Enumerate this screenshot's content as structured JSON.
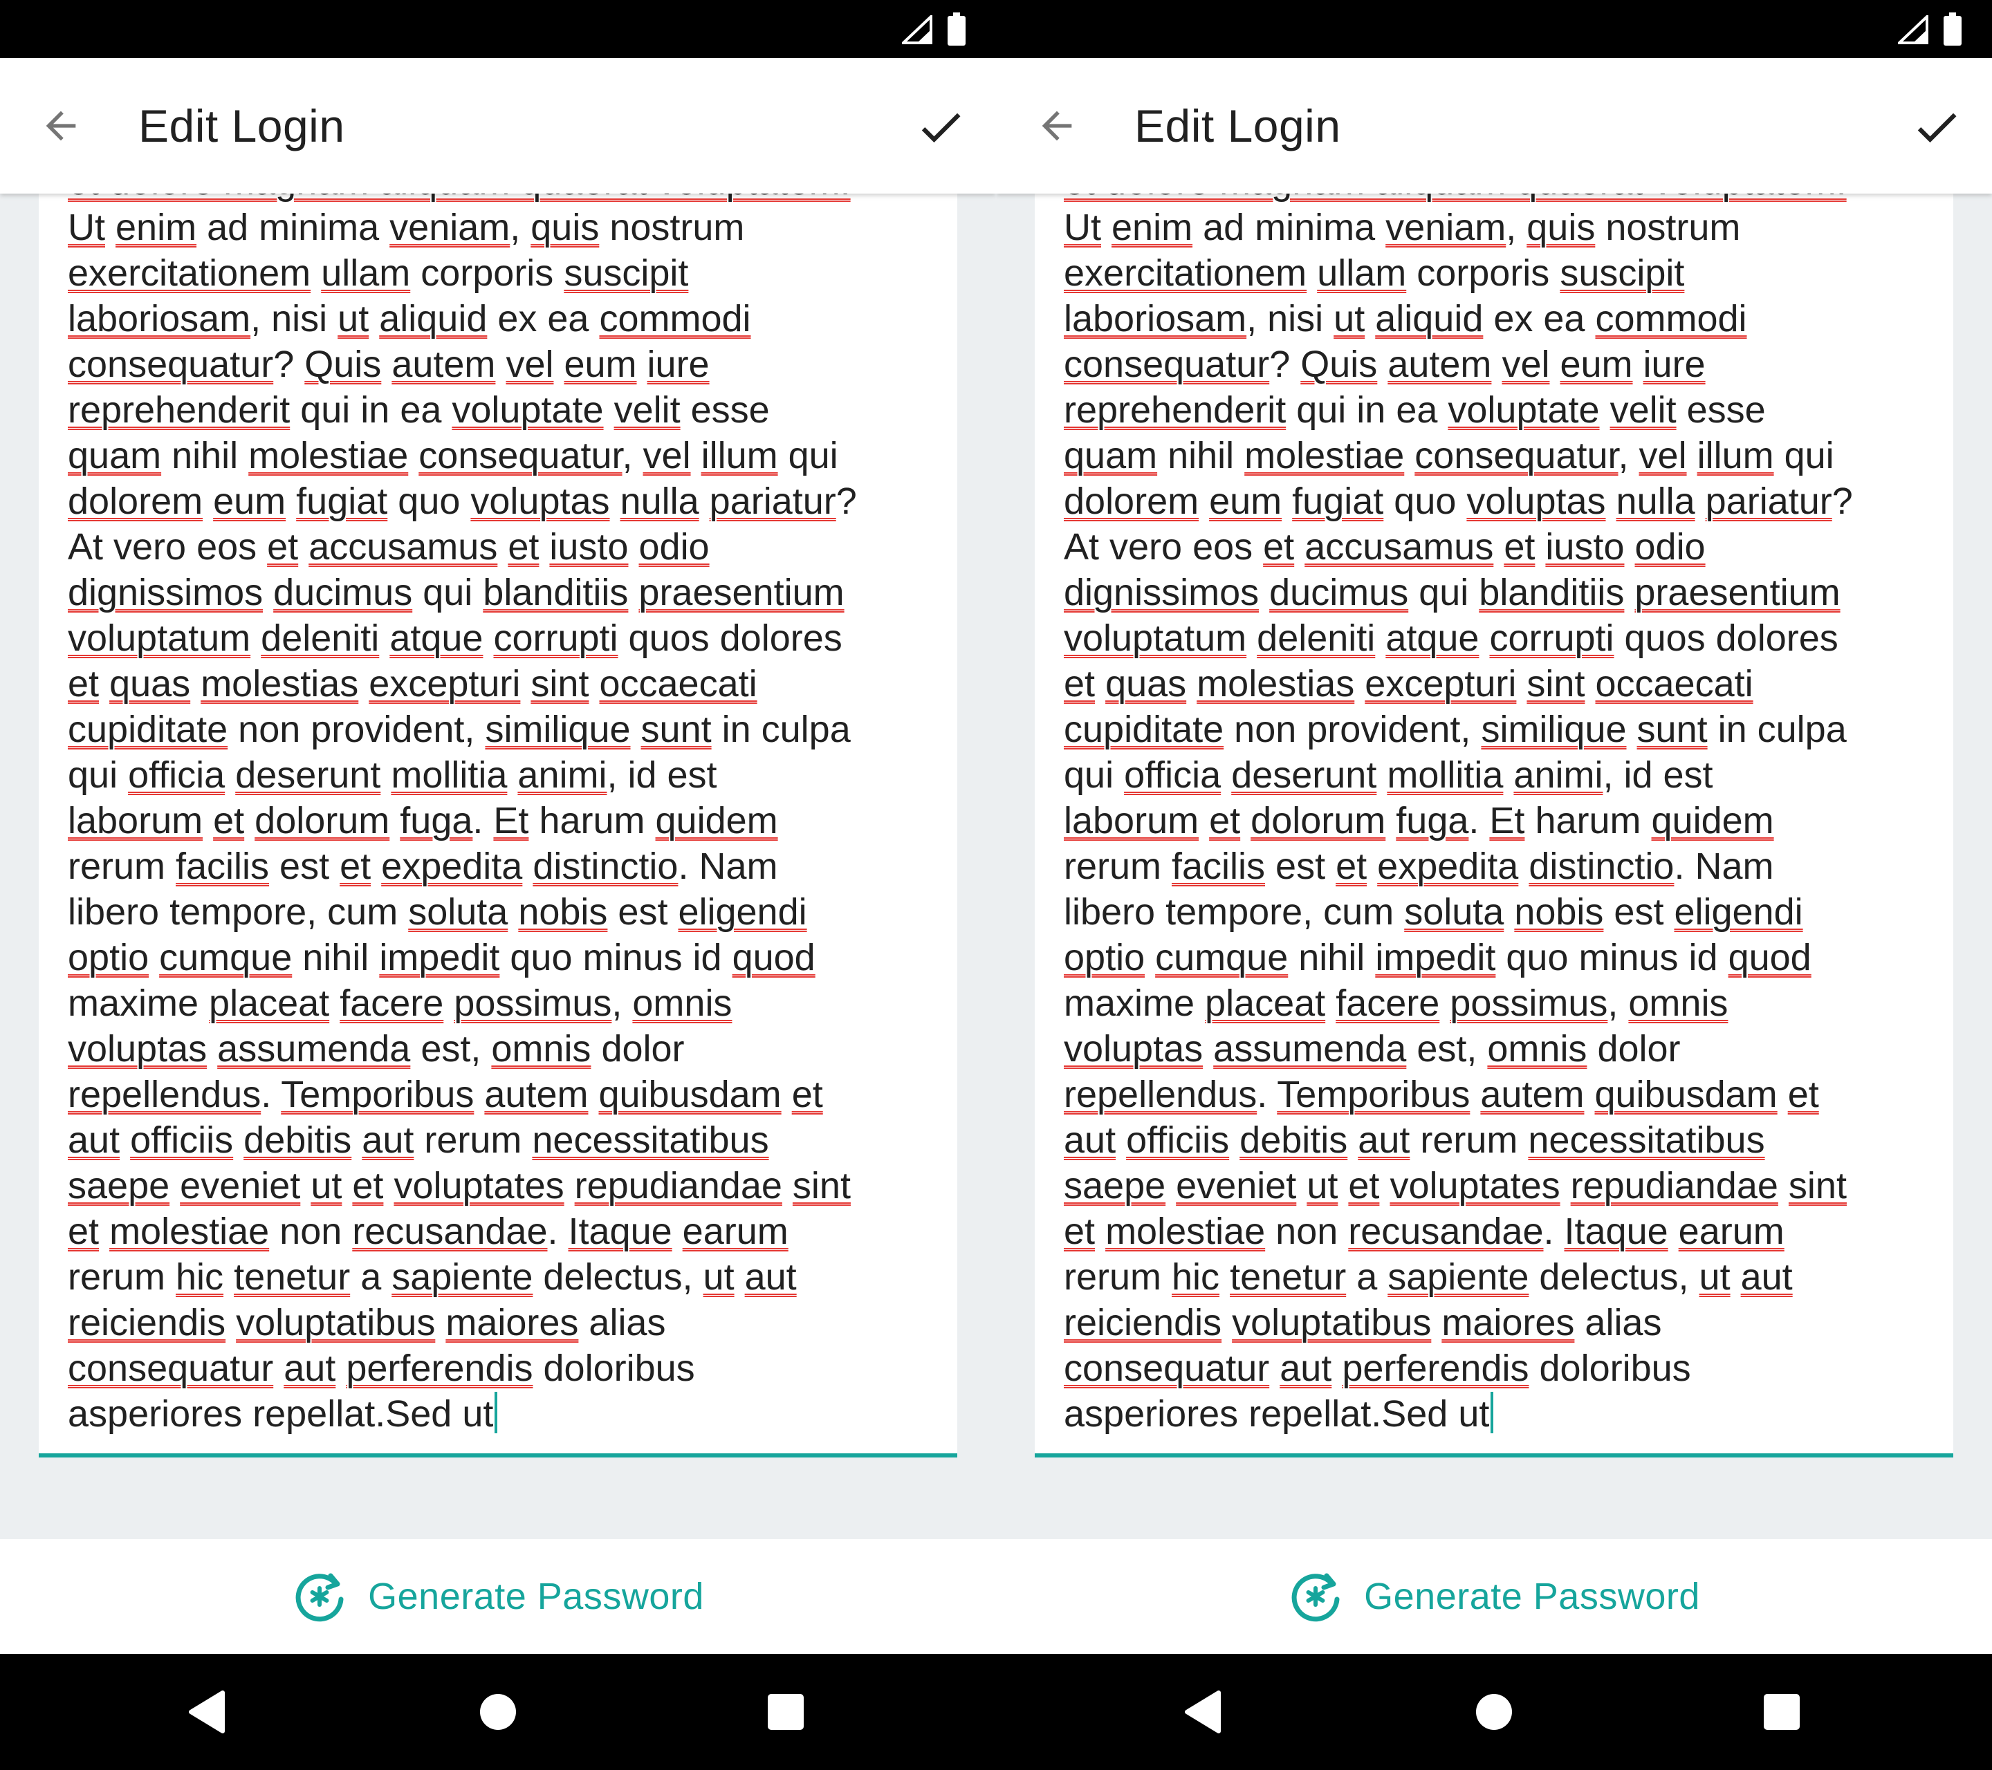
{
  "colors": {
    "accent": "#16a59c",
    "spell_error": "#e53935",
    "text": "#212121",
    "background": "#eceff1"
  },
  "icons": {
    "back": "arrow-left-icon",
    "save": "check-icon",
    "generate": "refresh-asterisk-icon",
    "signal": "signal-icon",
    "battery": "battery-icon",
    "nav_back": "triangle-back-icon",
    "nav_home": "circle-home-icon",
    "nav_recents": "square-recents-icon"
  },
  "screen": {
    "title": "Edit Login",
    "generate_label": "Generate Password",
    "editor_tokens": [
      {
        "t": "et dolore magnam aliquam quaerat voluptatem.\n",
        "s": true
      },
      {
        "t": "Ut",
        "s": true
      },
      {
        "t": " ",
        "s": false
      },
      {
        "t": "enim",
        "s": true
      },
      {
        "t": " ad minima ",
        "s": false
      },
      {
        "t": "veniam",
        "s": true
      },
      {
        "t": ", ",
        "s": false
      },
      {
        "t": "quis",
        "s": true
      },
      {
        "t": " nostrum\n",
        "s": false
      },
      {
        "t": "exercitationem",
        "s": true
      },
      {
        "t": " ",
        "s": false
      },
      {
        "t": "ullam",
        "s": true
      },
      {
        "t": " corporis ",
        "s": false
      },
      {
        "t": "suscipit",
        "s": true
      },
      {
        "t": "\n",
        "s": false
      },
      {
        "t": "laboriosam",
        "s": true
      },
      {
        "t": ", nisi ",
        "s": false
      },
      {
        "t": "ut",
        "s": true
      },
      {
        "t": " ",
        "s": false
      },
      {
        "t": "aliquid",
        "s": true
      },
      {
        "t": " ex ea ",
        "s": false
      },
      {
        "t": "commodi",
        "s": true
      },
      {
        "t": "\n",
        "s": false
      },
      {
        "t": "consequatur",
        "s": true
      },
      {
        "t": "? ",
        "s": false
      },
      {
        "t": "Quis",
        "s": true
      },
      {
        "t": " ",
        "s": false
      },
      {
        "t": "autem",
        "s": true
      },
      {
        "t": " ",
        "s": false
      },
      {
        "t": "vel",
        "s": true
      },
      {
        "t": " ",
        "s": false
      },
      {
        "t": "eum",
        "s": true
      },
      {
        "t": " ",
        "s": false
      },
      {
        "t": "iure",
        "s": true
      },
      {
        "t": "\n",
        "s": false
      },
      {
        "t": "reprehenderit",
        "s": true
      },
      {
        "t": " qui in ea ",
        "s": false
      },
      {
        "t": "voluptate",
        "s": true
      },
      {
        "t": " ",
        "s": false
      },
      {
        "t": "velit",
        "s": true
      },
      {
        "t": " esse\n",
        "s": false
      },
      {
        "t": "quam",
        "s": true
      },
      {
        "t": " nihil ",
        "s": false
      },
      {
        "t": "molestiae",
        "s": true
      },
      {
        "t": " ",
        "s": false
      },
      {
        "t": "consequatur",
        "s": true
      },
      {
        "t": ", ",
        "s": false
      },
      {
        "t": "vel",
        "s": true
      },
      {
        "t": " ",
        "s": false
      },
      {
        "t": "illum",
        "s": true
      },
      {
        "t": " qui\n",
        "s": false
      },
      {
        "t": "dolorem",
        "s": true
      },
      {
        "t": " ",
        "s": false
      },
      {
        "t": "eum",
        "s": true
      },
      {
        "t": " ",
        "s": false
      },
      {
        "t": "fugiat",
        "s": true
      },
      {
        "t": " quo ",
        "s": false
      },
      {
        "t": "voluptas",
        "s": true
      },
      {
        "t": " ",
        "s": false
      },
      {
        "t": "nulla",
        "s": true
      },
      {
        "t": " ",
        "s": false
      },
      {
        "t": "pariatur",
        "s": true
      },
      {
        "t": "?\n",
        "s": false
      },
      {
        "t": "At vero eos ",
        "s": false
      },
      {
        "t": "et",
        "s": true
      },
      {
        "t": " ",
        "s": false
      },
      {
        "t": "accusamus",
        "s": true
      },
      {
        "t": " ",
        "s": false
      },
      {
        "t": "et",
        "s": true
      },
      {
        "t": " ",
        "s": false
      },
      {
        "t": "iusto",
        "s": true
      },
      {
        "t": " ",
        "s": false
      },
      {
        "t": "odio",
        "s": true
      },
      {
        "t": "\n",
        "s": false
      },
      {
        "t": "dignissimos",
        "s": true
      },
      {
        "t": " ",
        "s": false
      },
      {
        "t": "ducimus",
        "s": true
      },
      {
        "t": " qui ",
        "s": false
      },
      {
        "t": "blanditiis",
        "s": true
      },
      {
        "t": " ",
        "s": false
      },
      {
        "t": "praesentium",
        "s": true
      },
      {
        "t": "\n",
        "s": false
      },
      {
        "t": "voluptatum",
        "s": true
      },
      {
        "t": " ",
        "s": false
      },
      {
        "t": "deleniti",
        "s": true
      },
      {
        "t": " ",
        "s": false
      },
      {
        "t": "atque",
        "s": true
      },
      {
        "t": " ",
        "s": false
      },
      {
        "t": "corrupti",
        "s": true
      },
      {
        "t": " quos dolores\n",
        "s": false
      },
      {
        "t": "et",
        "s": true
      },
      {
        "t": " ",
        "s": false
      },
      {
        "t": "quas",
        "s": true
      },
      {
        "t": " ",
        "s": false
      },
      {
        "t": "molestias",
        "s": true
      },
      {
        "t": " ",
        "s": false
      },
      {
        "t": "excepturi",
        "s": true
      },
      {
        "t": " ",
        "s": false
      },
      {
        "t": "sint",
        "s": true
      },
      {
        "t": " ",
        "s": false
      },
      {
        "t": "occaecati",
        "s": true
      },
      {
        "t": "\n",
        "s": false
      },
      {
        "t": "cupiditate",
        "s": true
      },
      {
        "t": " non provident, ",
        "s": false
      },
      {
        "t": "similique",
        "s": true
      },
      {
        "t": " ",
        "s": false
      },
      {
        "t": "sunt",
        "s": true
      },
      {
        "t": " in culpa\n",
        "s": false
      },
      {
        "t": "qui ",
        "s": false
      },
      {
        "t": "officia",
        "s": true
      },
      {
        "t": " ",
        "s": false
      },
      {
        "t": "deserunt",
        "s": true
      },
      {
        "t": " ",
        "s": false
      },
      {
        "t": "mollitia",
        "s": true
      },
      {
        "t": " ",
        "s": false
      },
      {
        "t": "animi",
        "s": true
      },
      {
        "t": ", id est\n",
        "s": false
      },
      {
        "t": "laborum",
        "s": true
      },
      {
        "t": " ",
        "s": false
      },
      {
        "t": "et",
        "s": true
      },
      {
        "t": " ",
        "s": false
      },
      {
        "t": "dolorum",
        "s": true
      },
      {
        "t": " ",
        "s": false
      },
      {
        "t": "fuga",
        "s": true
      },
      {
        "t": ". ",
        "s": false
      },
      {
        "t": "Et",
        "s": true
      },
      {
        "t": " harum ",
        "s": false
      },
      {
        "t": "quidem",
        "s": true
      },
      {
        "t": "\n",
        "s": false
      },
      {
        "t": "rerum ",
        "s": false
      },
      {
        "t": "facilis",
        "s": true
      },
      {
        "t": " est ",
        "s": false
      },
      {
        "t": "et",
        "s": true
      },
      {
        "t": " ",
        "s": false
      },
      {
        "t": "expedita",
        "s": true
      },
      {
        "t": " ",
        "s": false
      },
      {
        "t": "distinctio",
        "s": true
      },
      {
        "t": ". Nam\n",
        "s": false
      },
      {
        "t": "libero tempore, cum ",
        "s": false
      },
      {
        "t": "soluta",
        "s": true
      },
      {
        "t": " ",
        "s": false
      },
      {
        "t": "nobis",
        "s": true
      },
      {
        "t": " est ",
        "s": false
      },
      {
        "t": "eligendi",
        "s": true
      },
      {
        "t": "\n",
        "s": false
      },
      {
        "t": "optio",
        "s": true
      },
      {
        "t": " ",
        "s": false
      },
      {
        "t": "cumque",
        "s": true
      },
      {
        "t": " nihil ",
        "s": false
      },
      {
        "t": "impedit",
        "s": true
      },
      {
        "t": " quo minus id ",
        "s": false
      },
      {
        "t": "quod",
        "s": true
      },
      {
        "t": "\n",
        "s": false
      },
      {
        "t": "maxime ",
        "s": false
      },
      {
        "t": "placeat",
        "s": true
      },
      {
        "t": " ",
        "s": false
      },
      {
        "t": "facere",
        "s": true
      },
      {
        "t": " ",
        "s": false
      },
      {
        "t": "possimus",
        "s": true
      },
      {
        "t": ", ",
        "s": false
      },
      {
        "t": "omnis",
        "s": true
      },
      {
        "t": "\n",
        "s": false
      },
      {
        "t": "voluptas",
        "s": true
      },
      {
        "t": " ",
        "s": false
      },
      {
        "t": "assumenda",
        "s": true
      },
      {
        "t": " est, ",
        "s": false
      },
      {
        "t": "omnis",
        "s": true
      },
      {
        "t": " dolor\n",
        "s": false
      },
      {
        "t": "repellendus",
        "s": true
      },
      {
        "t": ". ",
        "s": false
      },
      {
        "t": "Temporibus",
        "s": true
      },
      {
        "t": " ",
        "s": false
      },
      {
        "t": "autem",
        "s": true
      },
      {
        "t": " ",
        "s": false
      },
      {
        "t": "quibusdam",
        "s": true
      },
      {
        "t": " ",
        "s": false
      },
      {
        "t": "et",
        "s": true
      },
      {
        "t": "\n",
        "s": false
      },
      {
        "t": "aut",
        "s": true
      },
      {
        "t": " ",
        "s": false
      },
      {
        "t": "officiis",
        "s": true
      },
      {
        "t": " ",
        "s": false
      },
      {
        "t": "debitis",
        "s": true
      },
      {
        "t": " ",
        "s": false
      },
      {
        "t": "aut",
        "s": true
      },
      {
        "t": " rerum ",
        "s": false
      },
      {
        "t": "necessitatibus",
        "s": true
      },
      {
        "t": "\n",
        "s": false
      },
      {
        "t": "saepe",
        "s": true
      },
      {
        "t": " ",
        "s": false
      },
      {
        "t": "eveniet",
        "s": true
      },
      {
        "t": " ",
        "s": false
      },
      {
        "t": "ut",
        "s": true
      },
      {
        "t": " ",
        "s": false
      },
      {
        "t": "et",
        "s": true
      },
      {
        "t": " ",
        "s": false
      },
      {
        "t": "voluptates",
        "s": true
      },
      {
        "t": " ",
        "s": false
      },
      {
        "t": "repudiandae",
        "s": true
      },
      {
        "t": " ",
        "s": false
      },
      {
        "t": "sint",
        "s": true
      },
      {
        "t": "\n",
        "s": false
      },
      {
        "t": "et",
        "s": true
      },
      {
        "t": " ",
        "s": false
      },
      {
        "t": "molestiae",
        "s": true
      },
      {
        "t": " non ",
        "s": false
      },
      {
        "t": "recusandae",
        "s": true
      },
      {
        "t": ". ",
        "s": false
      },
      {
        "t": "Itaque",
        "s": true
      },
      {
        "t": " ",
        "s": false
      },
      {
        "t": "earum",
        "s": true
      },
      {
        "t": "\n",
        "s": false
      },
      {
        "t": "rerum ",
        "s": false
      },
      {
        "t": "hic",
        "s": true
      },
      {
        "t": " ",
        "s": false
      },
      {
        "t": "tenetur",
        "s": true
      },
      {
        "t": " a ",
        "s": false
      },
      {
        "t": "sapiente",
        "s": true
      },
      {
        "t": " delectus, ",
        "s": false
      },
      {
        "t": "ut",
        "s": true
      },
      {
        "t": " ",
        "s": false
      },
      {
        "t": "aut",
        "s": true
      },
      {
        "t": "\n",
        "s": false
      },
      {
        "t": "reiciendis",
        "s": true
      },
      {
        "t": " ",
        "s": false
      },
      {
        "t": "voluptatibus",
        "s": true
      },
      {
        "t": " ",
        "s": false
      },
      {
        "t": "maiores",
        "s": true
      },
      {
        "t": " alias\n",
        "s": false
      },
      {
        "t": "consequatur",
        "s": true
      },
      {
        "t": " ",
        "s": false
      },
      {
        "t": "aut",
        "s": true
      },
      {
        "t": " ",
        "s": false
      },
      {
        "t": "perferendis",
        "s": true
      },
      {
        "t": " doloribus\n",
        "s": false
      },
      {
        "t": "asperiores repellat.Sed ut",
        "s": false
      }
    ]
  }
}
